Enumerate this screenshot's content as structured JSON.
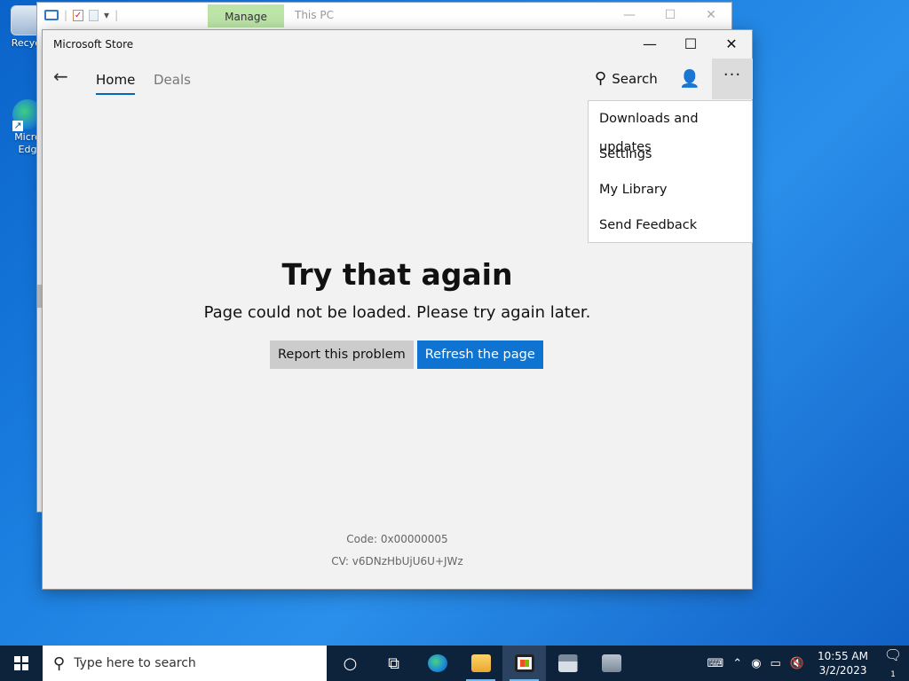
{
  "desktop": {
    "icons": [
      {
        "label": "Recyc"
      },
      {
        "label": "Micro Edg"
      }
    ]
  },
  "explorer": {
    "title": "This PC",
    "ribbon_context_tab": "Manage",
    "window_buttons": {
      "minimize": "—",
      "maximize": "☐",
      "close": "✕"
    }
  },
  "store": {
    "title": "Microsoft Store",
    "window_buttons": {
      "minimize": "—",
      "maximize": "☐",
      "close": "✕"
    },
    "nav": {
      "back": "←",
      "tabs": [
        {
          "label": "Home",
          "selected": true
        },
        {
          "label": "Deals",
          "selected": false
        }
      ],
      "search_label": "Search",
      "more_label": "···"
    },
    "menu": {
      "items": [
        {
          "label": "Downloads and updates"
        },
        {
          "label": "Settings"
        },
        {
          "label": "My Library"
        },
        {
          "label": "Send Feedback"
        }
      ]
    },
    "error": {
      "title": "Try that again",
      "message": "Page could not be loaded. Please try again later.",
      "report_button": "Report this problem",
      "refresh_button": "Refresh the page",
      "code": "Code: 0x00000005",
      "cv": "CV: v6DNzHbUjU6U+JWz"
    },
    "accent_color": "#0f73d1"
  },
  "taskbar": {
    "search_placeholder": "Type here to search",
    "clock": {
      "time": "10:55 AM",
      "date": "3/2/2023"
    },
    "notification_count": "1"
  }
}
